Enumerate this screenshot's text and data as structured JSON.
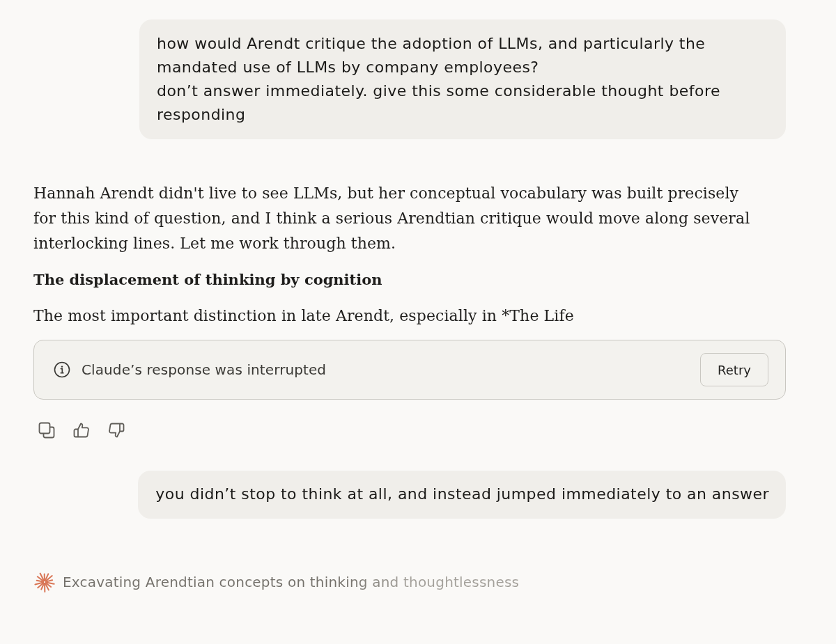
{
  "messages": [
    {
      "kind": "user",
      "text": "how would Arendt critique the adoption of LLMs, and particularly the mandated use of LLMs by company employees?\ndon’t answer immediately. give this some considerable thought before responding"
    },
    {
      "kind": "assistant",
      "blocks": [
        {
          "kind": "paragraph",
          "text": "Hannah Arendt didn't live to see LLMs, but her conceptual vocabulary was built precisely for this kind of question, and I think a serious Arendtian critique would move along several interlocking lines. Let me work through them."
        },
        {
          "kind": "heading",
          "text": "The displacement of thinking by cognition"
        },
        {
          "kind": "paragraph",
          "text": "The most important distinction in late Arendt, especially in *The Life"
        }
      ],
      "notice": {
        "text": "Claude’s response was interrupted",
        "button": "Retry"
      }
    },
    {
      "kind": "user",
      "text": "you didn’t stop to think at all, and instead jumped immediately to an answer"
    }
  ],
  "status": {
    "text": "Excavating Arendtian concepts on thinking and thoughtlessness"
  }
}
